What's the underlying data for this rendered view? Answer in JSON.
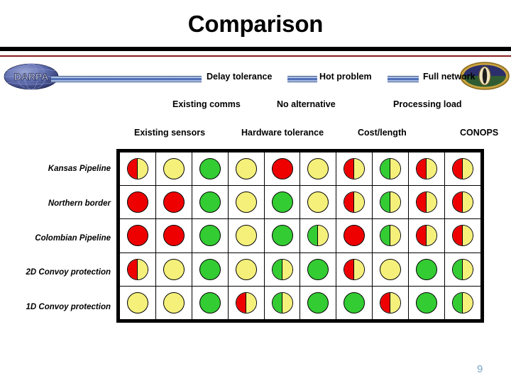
{
  "slide": {
    "title": "Comparison",
    "page_number": "9",
    "page_number_color": "#7ba7c7"
  },
  "branding": {
    "left_logo_text": "DARPA",
    "left_logo_name": "darpa-globe-logo",
    "right_logo_name": "gold-oval-seal-logo"
  },
  "header_rows": [
    {
      "row": 1,
      "labels": [
        "Delay tolerance",
        "Hot problem",
        "Full network"
      ]
    },
    {
      "row": 2,
      "labels": [
        "Existing comms",
        "No alternative",
        "Processing load"
      ]
    },
    {
      "row": 3,
      "labels": [
        "Existing sensors",
        "Hardware tolerance",
        "Cost/length",
        "CONOPS"
      ]
    }
  ],
  "colors": {
    "red": "#ee0000",
    "yellow": "#f5f07a",
    "green": "#33cc33",
    "rule_black": "#000000",
    "rule_red": "#8a1d1d",
    "blue_bar": "#3b5ca8"
  },
  "matrix": {
    "columns": 10,
    "rows": [
      {
        "label": "Kansas Pipeline",
        "cells": [
          {
            "type": "split",
            "left": "red",
            "right": "yellow"
          },
          {
            "type": "solid",
            "color": "yellow"
          },
          {
            "type": "solid",
            "color": "green"
          },
          {
            "type": "solid",
            "color": "yellow"
          },
          {
            "type": "solid",
            "color": "red"
          },
          {
            "type": "solid",
            "color": "yellow"
          },
          {
            "type": "split",
            "left": "red",
            "right": "yellow"
          },
          {
            "type": "split",
            "left": "green",
            "right": "yellow"
          },
          {
            "type": "split",
            "left": "red",
            "right": "yellow"
          },
          {
            "type": "split",
            "left": "red",
            "right": "yellow"
          }
        ]
      },
      {
        "label": "Northern border",
        "cells": [
          {
            "type": "solid",
            "color": "red"
          },
          {
            "type": "solid",
            "color": "red"
          },
          {
            "type": "solid",
            "color": "green"
          },
          {
            "type": "solid",
            "color": "yellow"
          },
          {
            "type": "solid",
            "color": "green"
          },
          {
            "type": "solid",
            "color": "yellow"
          },
          {
            "type": "split",
            "left": "red",
            "right": "yellow"
          },
          {
            "type": "split",
            "left": "green",
            "right": "yellow"
          },
          {
            "type": "split",
            "left": "red",
            "right": "yellow"
          },
          {
            "type": "split",
            "left": "red",
            "right": "yellow"
          }
        ]
      },
      {
        "label": "Colombian Pipeline",
        "cells": [
          {
            "type": "solid",
            "color": "red"
          },
          {
            "type": "solid",
            "color": "red"
          },
          {
            "type": "solid",
            "color": "green"
          },
          {
            "type": "solid",
            "color": "yellow"
          },
          {
            "type": "solid",
            "color": "green"
          },
          {
            "type": "split",
            "left": "green",
            "right": "yellow"
          },
          {
            "type": "solid",
            "color": "red"
          },
          {
            "type": "split",
            "left": "green",
            "right": "yellow"
          },
          {
            "type": "split",
            "left": "red",
            "right": "yellow"
          },
          {
            "type": "split",
            "left": "red",
            "right": "yellow"
          }
        ]
      },
      {
        "label": "2D Convoy protection",
        "cells": [
          {
            "type": "split",
            "left": "red",
            "right": "yellow"
          },
          {
            "type": "solid",
            "color": "yellow"
          },
          {
            "type": "solid",
            "color": "green"
          },
          {
            "type": "solid",
            "color": "yellow"
          },
          {
            "type": "split",
            "left": "green",
            "right": "yellow"
          },
          {
            "type": "solid",
            "color": "green"
          },
          {
            "type": "split",
            "left": "red",
            "right": "yellow"
          },
          {
            "type": "solid",
            "color": "yellow"
          },
          {
            "type": "solid",
            "color": "green"
          },
          {
            "type": "split",
            "left": "green",
            "right": "yellow"
          }
        ]
      },
      {
        "label": "1D Convoy protection",
        "cells": [
          {
            "type": "solid",
            "color": "yellow"
          },
          {
            "type": "solid",
            "color": "yellow"
          },
          {
            "type": "solid",
            "color": "green"
          },
          {
            "type": "split",
            "left": "red",
            "right": "yellow"
          },
          {
            "type": "split",
            "left": "green",
            "right": "yellow"
          },
          {
            "type": "solid",
            "color": "green"
          },
          {
            "type": "solid",
            "color": "green"
          },
          {
            "type": "split",
            "left": "red",
            "right": "yellow"
          },
          {
            "type": "solid",
            "color": "green"
          },
          {
            "type": "split",
            "left": "green",
            "right": "yellow"
          }
        ]
      }
    ]
  }
}
